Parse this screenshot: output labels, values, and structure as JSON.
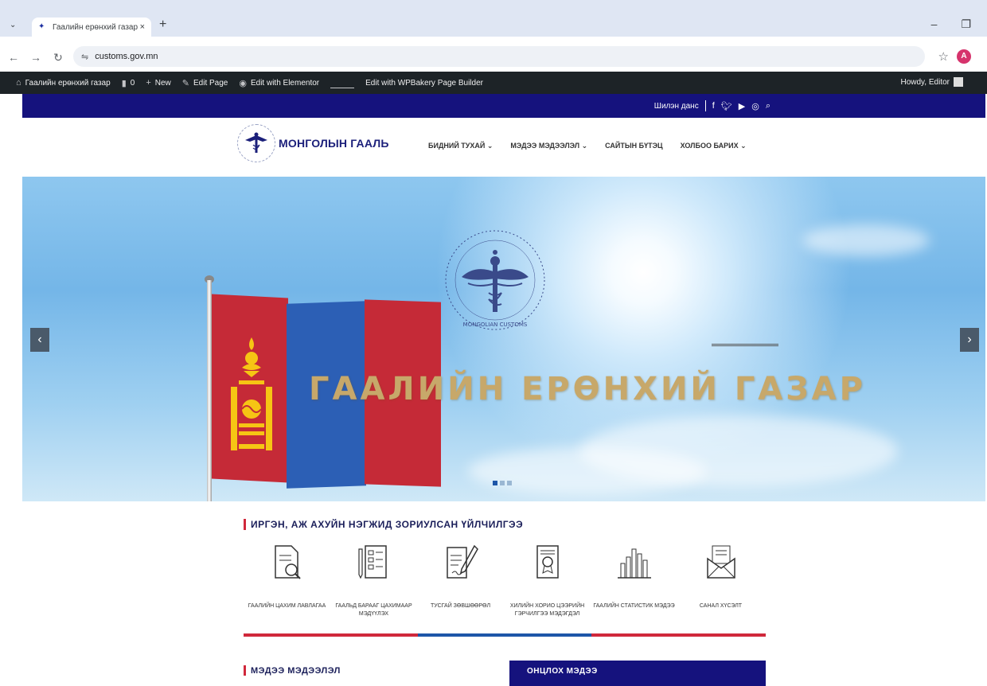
{
  "browser": {
    "tab_title": "Гаалийн ерөнхий газар",
    "tab_close": "×",
    "new_tab": "+",
    "url": "customs.gov.mn",
    "profile_initial": "A",
    "minimize": "–",
    "restore": "❐"
  },
  "wp_admin_bar": {
    "site_name": "Гаалийн ерөнхий газар",
    "comments_count": "0",
    "new_label": "New",
    "edit_page_label": "Edit Page",
    "elementor_label": "Edit with Elementor",
    "wpbakery_label": "Edit with WPBakery Page Builder",
    "howdy_label": "Howdy, Editor"
  },
  "top_strip": {
    "account_label": "Шилэн данс"
  },
  "header": {
    "logo_text": "МОНГОЛЫН ГААЛЬ",
    "nav": [
      {
        "label": "БИДНИЙ ТУХАЙ",
        "has_dropdown": true
      },
      {
        "label": "МЭДЭЭ МЭДЭЭЛЭЛ",
        "has_dropdown": true
      },
      {
        "label": "САЙТЫН БҮТЭЦ",
        "has_dropdown": false
      },
      {
        "label": "ХОЛБОО БАРИХ",
        "has_dropdown": true
      }
    ]
  },
  "hero": {
    "title": "ГААЛИЙН ЕРӨНХИЙ ГАЗАР",
    "emblem_text": "MONGOLIAN CUSTOMS",
    "prev": "‹",
    "next": "›",
    "slides": 3,
    "active_slide": 1
  },
  "services": {
    "title": "ИРГЭН, АЖ АХУЙН НЭГЖИД ЗОРИУЛСАН ҮЙЛЧИЛГЭЭ",
    "items": [
      {
        "label": "ГААЛИЙН ЦАХИМ ЛАВЛАГАА",
        "icon": "document-search-icon"
      },
      {
        "label": "ГААЛЬД БАРААГ ЦАХИМААР МЭДҮҮЛЭХ",
        "icon": "form-pencil-icon"
      },
      {
        "label": "ТУСГАЙ ЗӨВШӨӨРӨЛ",
        "icon": "permit-document-icon"
      },
      {
        "label": "ХИЛИЙН ХОРИО ЦЭЭРИЙН ГЭРЧИЛГЭЭ МЭДЭГДЭЛ",
        "icon": "certificate-icon"
      },
      {
        "label": "ГААЛИЙН СТАТИСТИК МЭДЭЭ",
        "icon": "bar-chart-icon"
      },
      {
        "label": "САНАЛ ХҮСЭЛТ",
        "icon": "envelope-icon"
      }
    ],
    "stripe_colors": [
      "#d0283b",
      "#1d56a8",
      "#d0283b"
    ]
  },
  "news": {
    "title": "МЭДЭЭ МЭДЭЭЛЭЛ",
    "featured_label": "ОНЦЛОХ МЭДЭЭ"
  },
  "colors": {
    "navy": "#15127d",
    "accent_red": "#d0283b",
    "hero_title": "#c7a86a"
  }
}
